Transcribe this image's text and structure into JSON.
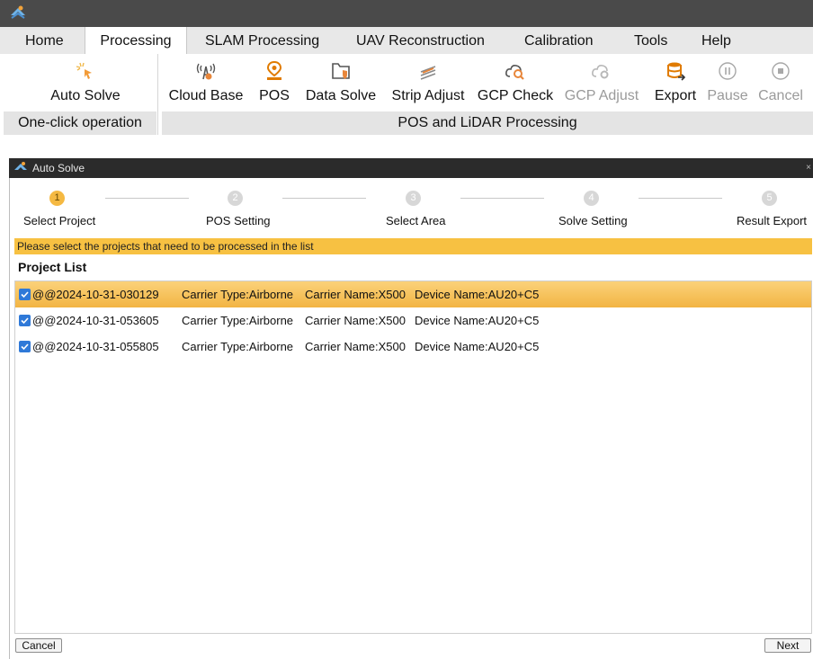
{
  "menu": {
    "tabs": [
      "Home",
      "Processing",
      "SLAM Processing",
      "UAV Reconstruction",
      "Calibration",
      "Tools",
      "Help"
    ],
    "active": "Processing"
  },
  "ribbon": {
    "auto_solve": "Auto Solve",
    "cloud_base": "Cloud Base",
    "pos": "POS",
    "data_solve": "Data Solve",
    "strip_adjust": "Strip Adjust",
    "gcp_check": "GCP Check",
    "gcp_adjust": "GCP Adjust",
    "export": "Export",
    "pause": "Pause",
    "cancel": "Cancel",
    "group_one_click": "One-click operation",
    "group_pos_lidar": "POS and LiDAR Processing"
  },
  "dialog": {
    "title": "Auto Solve",
    "close": "×",
    "steps": [
      {
        "num": "1",
        "label": "Select Project",
        "active": true
      },
      {
        "num": "2",
        "label": "POS Setting",
        "active": false
      },
      {
        "num": "3",
        "label": "Select Area",
        "active": false
      },
      {
        "num": "4",
        "label": "Solve Setting",
        "active": false
      },
      {
        "num": "5",
        "label": "Result Export",
        "active": false
      }
    ],
    "notice": "Please select the projects that need to be processed in the list",
    "list_title": "Project List",
    "projects": [
      {
        "name": "@@2024-10-31-030129",
        "carrier_type": "Carrier Type:Airborne",
        "carrier_name": "Carrier Name:X500",
        "device_name": "Device Name:AU20+C5",
        "checked": true,
        "selected": true
      },
      {
        "name": "@@2024-10-31-053605",
        "carrier_type": "Carrier Type:Airborne",
        "carrier_name": "Carrier Name:X500",
        "device_name": "Device Name:AU20+C5",
        "checked": true,
        "selected": false
      },
      {
        "name": "@@2024-10-31-055805",
        "carrier_type": "Carrier Type:Airborne",
        "carrier_name": "Carrier Name:X500",
        "device_name": "Device Name:AU20+C5",
        "checked": true,
        "selected": false
      }
    ],
    "cancel_button": "Cancel",
    "next_button": "Next"
  },
  "colors": {
    "accent": "#f5b942",
    "checkbox": "#2f79d8",
    "pos_icon": "#e07b00",
    "export_icon": "#e07b00"
  }
}
